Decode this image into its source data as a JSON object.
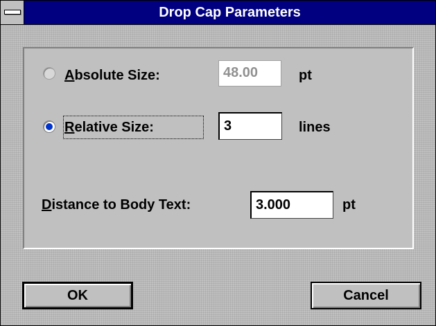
{
  "window": {
    "title": "Drop Cap Parameters"
  },
  "absolute_size": {
    "label_hotkey": "A",
    "label_rest": "bsolute Size:",
    "value": "48.00",
    "unit": "pt",
    "selected": false
  },
  "relative_size": {
    "label_hotkey": "R",
    "label_rest": "elative Size:",
    "value": "3",
    "unit": "lines",
    "selected": true
  },
  "distance": {
    "label_hotkey": "D",
    "label_rest": "istance to Body Text:",
    "value": "3.000",
    "unit": "pt"
  },
  "buttons": {
    "ok": "OK",
    "cancel": "Cancel"
  },
  "colors": {
    "title_bar": "#000080",
    "face": "#c0c0c0",
    "radio_dot": "#0033cc"
  }
}
